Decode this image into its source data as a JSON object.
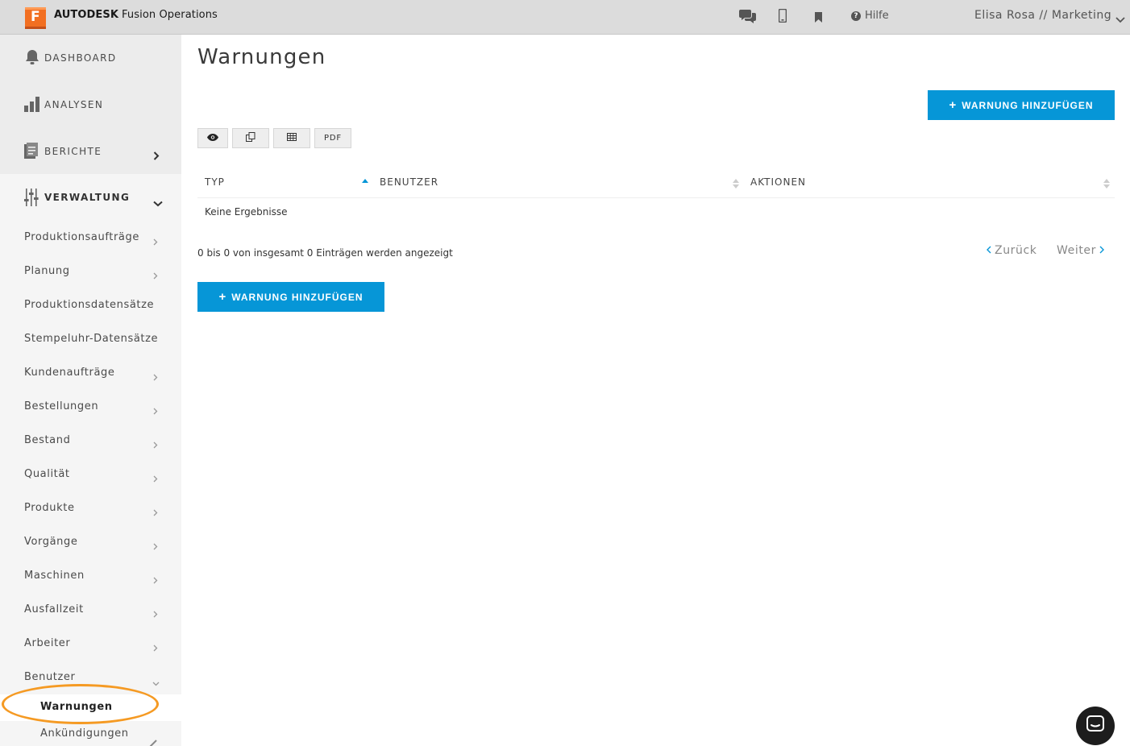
{
  "header": {
    "brand_bold": "AUTODESK",
    "brand_rest": "Fusion Operations",
    "logo_letter": "F",
    "help_label": "Hilfe",
    "user_label": "Elisa Rosa // Marketing",
    "icons": [
      "chat-icon",
      "mobile-icon",
      "bookmark-icon",
      "help-icon",
      "chevron-down-icon"
    ]
  },
  "sidebar": {
    "main": [
      {
        "label": "DASHBOARD",
        "icon": "bell-icon"
      },
      {
        "label": "ANALYSEN",
        "icon": "bar-chart-icon"
      },
      {
        "label": "BERICHTE",
        "icon": "document-icon"
      },
      {
        "label": "VERWALTUNG",
        "icon": "sliders-icon"
      }
    ],
    "items": [
      {
        "label": "Produktionsaufträge",
        "chevron": true
      },
      {
        "label": "Planung",
        "chevron": true
      },
      {
        "label": "Produktionsdatensätze",
        "chevron": false
      },
      {
        "label": "Stempeluhr-Datensätze",
        "chevron": false
      },
      {
        "label": "Kundenaufträge",
        "chevron": true
      },
      {
        "label": "Bestellungen",
        "chevron": true
      },
      {
        "label": "Bestand",
        "chevron": true
      },
      {
        "label": "Qualität",
        "chevron": true
      },
      {
        "label": "Produkte",
        "chevron": true
      },
      {
        "label": "Vorgänge",
        "chevron": true
      },
      {
        "label": "Maschinen",
        "chevron": true
      },
      {
        "label": "Ausfallzeit",
        "chevron": true
      },
      {
        "label": "Arbeiter",
        "chevron": true
      },
      {
        "label": "Benutzer",
        "chevron": true
      }
    ],
    "subitems": [
      {
        "label": "Warnungen",
        "active": true
      },
      {
        "label": "Ankündigungen",
        "active": false
      }
    ]
  },
  "main": {
    "title": "Warnungen",
    "add_button_label": "WARNUNG HINZUFÜGEN",
    "toolbar": {
      "pdf_label": "PDF"
    },
    "table": {
      "columns": [
        "TYP",
        "BENUTZER",
        "AKTIONEN"
      ],
      "empty_text": "Keine Ergebnisse"
    },
    "info_text": "0 bis 0 von insgesamt 0 Einträgen werden angezeigt",
    "pager": {
      "prev": "Zurück",
      "next": "Weiter"
    }
  },
  "colors": {
    "accent": "#0696d7",
    "highlight": "#f59a23",
    "logo": "#f26f21"
  }
}
